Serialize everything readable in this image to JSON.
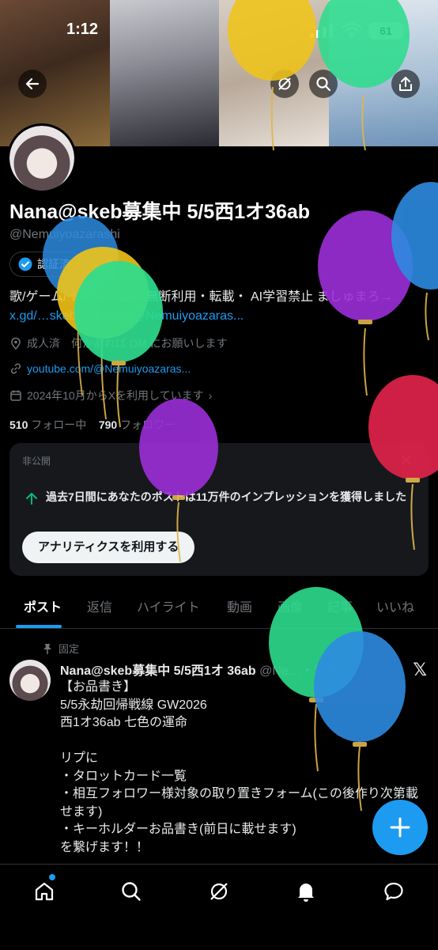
{
  "status_bar": {
    "time": "1:12",
    "battery": "61"
  },
  "profile": {
    "name": "Nana@skeb募集中 5/5西1オ36ab",
    "handle": "@Nemuiyoazarashi",
    "verify_label": "認証済",
    "bio_text": "歌/ゲーム/イラストなど 無断利用・転載・ AI学習禁止 ましゅまろ→ ",
    "bio_link": "x.gd/…skeb→skeb.jp/@Nemuiyoazaras...",
    "location": "成人済　何かあれば DM にお願いします",
    "website": "youtube.com/@Nemuiyoazaras...",
    "joined": "2024年10月からXを利用しています",
    "following_count": "510",
    "following_label": "フォロー中",
    "followers_count": "790",
    "followers_label": "フォロワー"
  },
  "private_card": {
    "label": "非公開",
    "message": "過去7日間にあなたのポストは11万件のインプレッションを獲得しました",
    "button": "アナリティクスを利用する"
  },
  "tabs": [
    "ポスト",
    "返信",
    "ハイライト",
    "動画",
    "画像",
    "記事",
    "いいね"
  ],
  "pinned_post": {
    "pinned_label": "固定",
    "author": "Nana@skeb募集中 5/5西1オ 36ab",
    "handle_date": "@Ne…・12日",
    "lines": [
      "【お品書き】",
      "5/5永劫回帰戦線 GW2026",
      "西1オ36ab 七色の運命",
      "",
      "リプに",
      "・タロットカード一覧",
      "・相互フォロワー様対象の取り置きフォーム(この後作り次第載せます)",
      "・キーホルダーお品書き(前日に載せます)",
      "を繋げます！！"
    ]
  },
  "colors": {
    "accent": "#1d9bf0",
    "background": "#000000",
    "text": "#e7e9ea",
    "muted": "#71767b"
  },
  "icons": [
    "back-arrow-icon",
    "grok-icon",
    "search-icon",
    "share-icon",
    "verified-icon",
    "location-icon",
    "link-icon",
    "calendar-icon",
    "impressions-arrow-icon",
    "pin-icon",
    "x-logo-icon",
    "home-icon",
    "search-nav-icon",
    "grok-nav-icon",
    "bell-icon",
    "messages-icon",
    "plus-icon"
  ]
}
